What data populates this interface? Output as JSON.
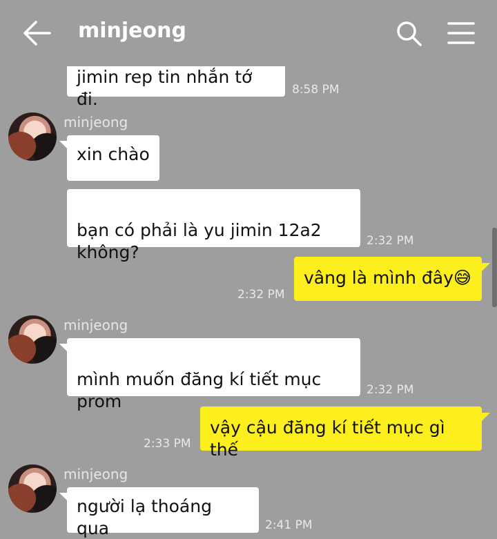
{
  "header": {
    "title": "minjeong",
    "back_icon": "arrow-left-icon",
    "search_icon": "search-icon",
    "menu_icon": "hamburger-menu-icon"
  },
  "colors": {
    "background": "#9e9e9e",
    "my_bubble": "#fdee1d",
    "their_bubble": "#ffffff"
  },
  "messages": [
    {
      "from": "me-partial",
      "text": "jimin rep tin nhắn tớ đi.",
      "time": "8:58 PM"
    },
    {
      "from": "minjeong",
      "sender": "minjeong",
      "text": "xin chào",
      "time": ""
    },
    {
      "from": "minjeong",
      "text": "bạn có phải là yu jimin 12a2\nkhông?",
      "time": "2:32 PM"
    },
    {
      "from": "me",
      "text": "vâng là mình đây😅",
      "time": "2:32 PM"
    },
    {
      "from": "minjeong",
      "sender": "minjeong",
      "text": "mình muốn đăng kí tiết mục\nprom",
      "time": "2:32 PM"
    },
    {
      "from": "me",
      "text": "vậy cậu đăng kí tiết mục gì thế",
      "time": "2:33 PM"
    },
    {
      "from": "minjeong",
      "sender": "minjeong",
      "text": "người lạ thoáng qua",
      "time": "2:41 PM"
    }
  ]
}
